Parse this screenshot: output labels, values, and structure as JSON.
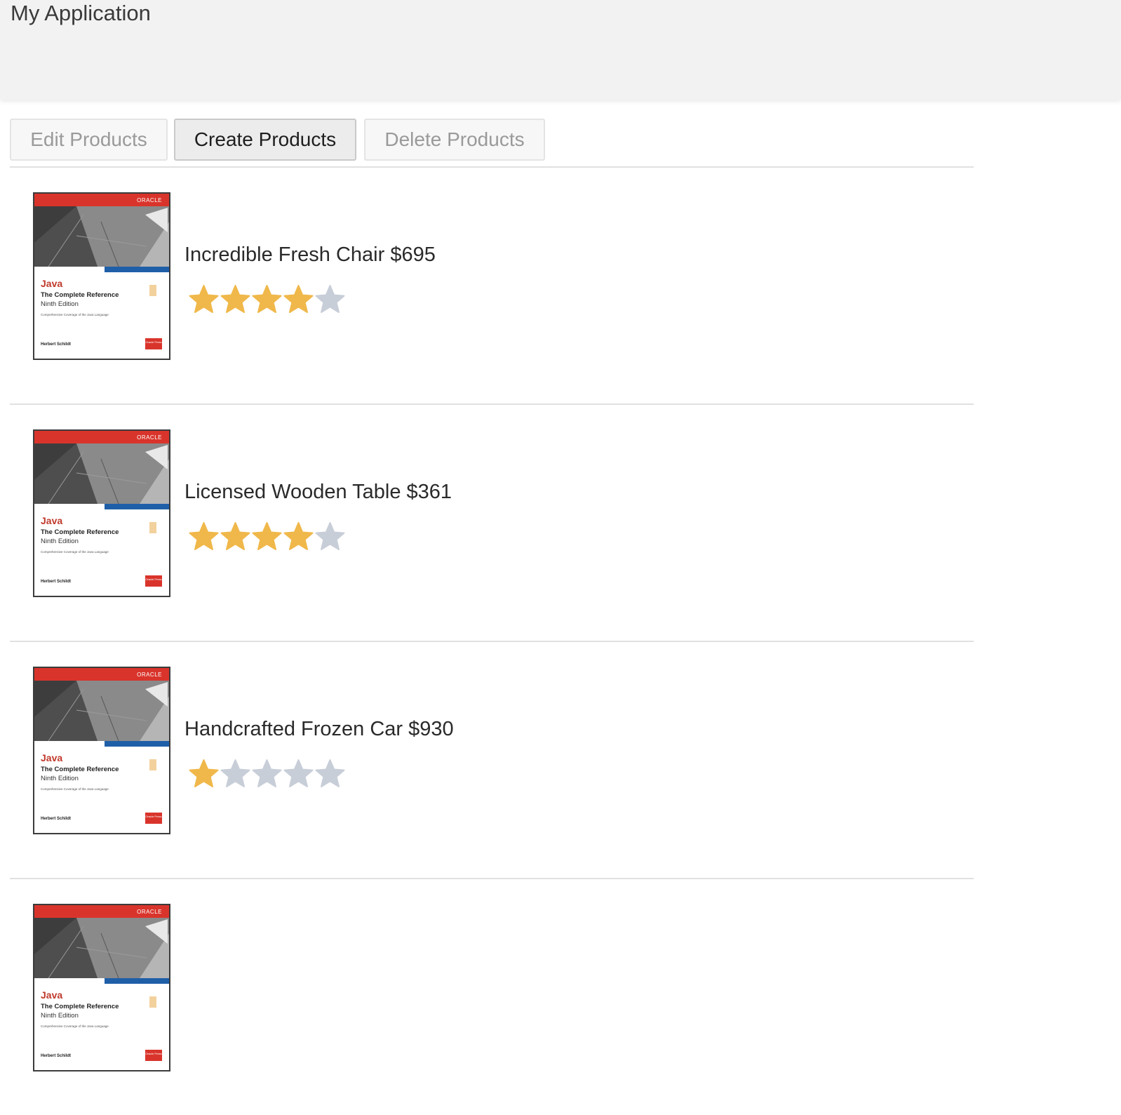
{
  "app": {
    "title": "My Application"
  },
  "tabs": [
    {
      "label": "Edit Products",
      "active": false
    },
    {
      "label": "Create Products",
      "active": true
    },
    {
      "label": "Delete Products",
      "active": false
    }
  ],
  "colors": {
    "star_filled": "#f0b84a",
    "star_empty": "#c8ced8",
    "cover_band": "#d9342b"
  },
  "book_cover": {
    "brand": "ORACLE",
    "title": "Java",
    "subtitle": "The Complete Reference",
    "edition": "Ninth Edition",
    "tagline": "Comprehensive Coverage of the Java Language",
    "author": "Herbert Schildt",
    "badge": "Oracle Press"
  },
  "products": [
    {
      "name": "Incredible Fresh Chair $695",
      "rating": 4,
      "max_rating": 5
    },
    {
      "name": "Licensed Wooden Table $361",
      "rating": 4,
      "max_rating": 5
    },
    {
      "name": "Handcrafted Frozen Car $930",
      "rating": 1,
      "max_rating": 5
    }
  ]
}
